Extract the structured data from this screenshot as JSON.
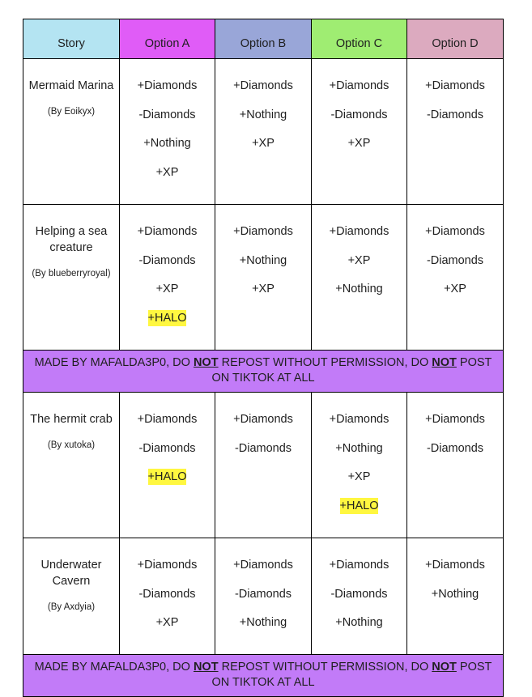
{
  "header": {
    "story": "Story",
    "options": [
      "Option A",
      "Option B",
      "Option C",
      "Option D"
    ]
  },
  "colors": {
    "story_header": "#b4e4f2",
    "option_a": "#e05cf7",
    "option_b": "#99a6d8",
    "option_c": "#9fed72",
    "option_d": "#dcaabf",
    "banner": "#c27bf8",
    "highlight": "#fff740"
  },
  "rows": [
    {
      "title": "Mermaid Marina",
      "author": "(By Eoikyx)",
      "a": [
        "+Diamonds",
        "-Diamonds",
        "+Nothing",
        "+XP"
      ],
      "b": [
        "+Diamonds",
        "+Nothing",
        "+XP"
      ],
      "c": [
        "+Diamonds",
        "-Diamonds",
        "+XP"
      ],
      "d": [
        "+Diamonds",
        "-Diamonds"
      ]
    },
    {
      "title": "Helping a sea creature",
      "author": "(By blueberryroyal)",
      "a": [
        "+Diamonds",
        "-Diamonds",
        "+XP",
        "+HALO"
      ],
      "b": [
        "+Diamonds",
        "+Nothing",
        "+XP"
      ],
      "c": [
        "+Diamonds",
        "+XP",
        "+Nothing"
      ],
      "d": [
        "+Diamonds",
        "-Diamonds",
        "+XP"
      ]
    },
    {
      "title": "The hermit crab",
      "author": "(By xutoka)",
      "a": [
        "+Diamonds",
        "-Diamonds",
        "+HALO"
      ],
      "b": [
        "+Diamonds",
        "-Diamonds"
      ],
      "c": [
        "+Diamonds",
        "+Nothing",
        "+XP",
        "+HALO"
      ],
      "d": [
        "+Diamonds",
        "-Diamonds"
      ]
    },
    {
      "title": "Underwater Cavern",
      "author": "(By Axdyia)",
      "a": [
        "+Diamonds",
        "-Diamonds",
        "+XP"
      ],
      "b": [
        "+Diamonds",
        "-Diamonds",
        "+Nothing"
      ],
      "c": [
        "+Diamonds",
        "-Diamonds",
        "+Nothing"
      ],
      "d": [
        "+Diamonds",
        "+Nothing"
      ]
    }
  ],
  "banner": {
    "part1": "MADE BY MAFALDA3P0, DO ",
    "emph1": "NOT",
    "part2": " REPOST WITHOUT PERMISSION, DO ",
    "emph2": "NOT",
    "part3": " POST ON TIKTOK AT ALL"
  }
}
